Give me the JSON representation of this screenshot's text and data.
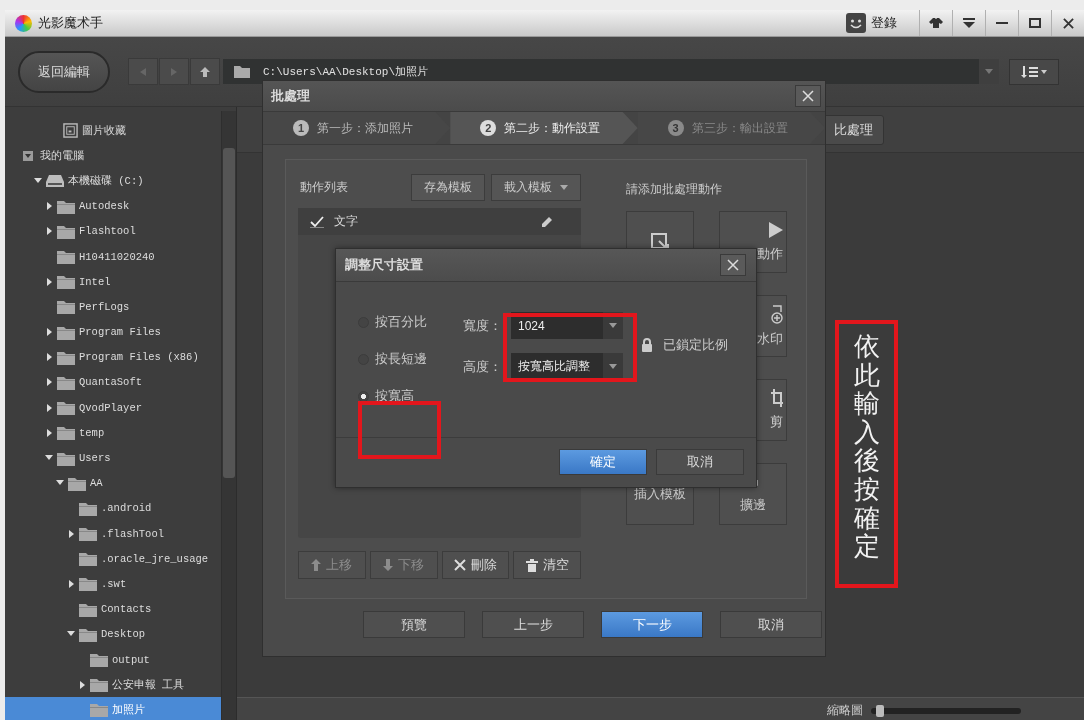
{
  "window": {
    "title": "光影魔术手",
    "login": "登錄"
  },
  "toolbar": {
    "back_button": "返回編輯",
    "path": "C:\\Users\\AA\\Desktop\\加照片"
  },
  "sidebar": {
    "tree": [
      {
        "label": "圖片收藏",
        "kind": "album",
        "expandable": false,
        "expanded": false,
        "selected": false
      },
      {
        "label": "我的電腦",
        "kind": "computer",
        "expandable": true,
        "expanded": true,
        "selected": false,
        "children": [
          {
            "label": "本機磁碟 (C:)",
            "kind": "drive",
            "expandable": true,
            "expanded": true,
            "selected": false,
            "children": [
              {
                "label": "Autodesk",
                "kind": "folder",
                "expandable": true,
                "expanded": false,
                "selected": false
              },
              {
                "label": "Flashtool",
                "kind": "folder",
                "expandable": true,
                "expanded": false,
                "selected": false
              },
              {
                "label": "H10411020240",
                "kind": "folder",
                "expandable": false,
                "expanded": false,
                "selected": false
              },
              {
                "label": "Intel",
                "kind": "folder",
                "expandable": true,
                "expanded": false,
                "selected": false
              },
              {
                "label": "PerfLogs",
                "kind": "folder",
                "expandable": false,
                "expanded": false,
                "selected": false
              },
              {
                "label": "Program Files",
                "kind": "folder",
                "expandable": true,
                "expanded": false,
                "selected": false
              },
              {
                "label": "Program Files (x86)",
                "kind": "folder",
                "expandable": true,
                "expanded": false,
                "selected": false
              },
              {
                "label": "QuantaSoft",
                "kind": "folder",
                "expandable": true,
                "expanded": false,
                "selected": false
              },
              {
                "label": "QvodPlayer",
                "kind": "folder",
                "expandable": true,
                "expanded": false,
                "selected": false
              },
              {
                "label": "temp",
                "kind": "folder",
                "expandable": true,
                "expanded": false,
                "selected": false
              },
              {
                "label": "Users",
                "kind": "folder",
                "expandable": true,
                "expanded": true,
                "selected": false,
                "children": [
                  {
                    "label": "AA",
                    "kind": "folder",
                    "expandable": true,
                    "expanded": true,
                    "selected": false,
                    "children": [
                      {
                        "label": ".android",
                        "kind": "folder",
                        "expandable": false,
                        "expanded": false,
                        "selected": false
                      },
                      {
                        "label": ".flashTool",
                        "kind": "folder",
                        "expandable": true,
                        "expanded": false,
                        "selected": false
                      },
                      {
                        "label": ".oracle_jre_usage",
                        "kind": "folder",
                        "expandable": false,
                        "expanded": false,
                        "selected": false
                      },
                      {
                        "label": ".swt",
                        "kind": "folder",
                        "expandable": true,
                        "expanded": false,
                        "selected": false
                      },
                      {
                        "label": "Contacts",
                        "kind": "folder",
                        "expandable": false,
                        "expanded": false,
                        "selected": false
                      },
                      {
                        "label": "Desktop",
                        "kind": "folder",
                        "expandable": true,
                        "expanded": true,
                        "selected": false,
                        "children": [
                          {
                            "label": "output",
                            "kind": "folder",
                            "expandable": false,
                            "expanded": false,
                            "selected": false
                          },
                          {
                            "label": "公安申報 工具",
                            "kind": "folder",
                            "expandable": true,
                            "expanded": false,
                            "selected": false
                          },
                          {
                            "label": "加照片",
                            "kind": "folder",
                            "expandable": false,
                            "expanded": false,
                            "selected": true
                          }
                        ]
                      }
                    ]
                  }
                ]
              }
            ]
          }
        ]
      }
    ]
  },
  "content": {
    "batch_button": "比處理",
    "status_bar": {
      "thumbnail_label": "縮略圖",
      "zoom": {
        "level": 0.03
      }
    }
  },
  "batch_dialog": {
    "title": "批處理",
    "steps": [
      {
        "number": "1",
        "label": "第一步：添加照片",
        "selected": false,
        "disabled": false
      },
      {
        "number": "2",
        "label": "第二步：動作設置",
        "selected": true,
        "disabled": false
      },
      {
        "number": "3",
        "label": "第三步：輸出設置",
        "selected": false,
        "disabled": true
      }
    ],
    "action_list": {
      "title": "動作列表",
      "save_template": "存為模板",
      "load_template": "載入模板",
      "items": [
        {
          "label": "文字",
          "checked": true
        }
      ],
      "buttons": [
        {
          "label": "上移",
          "kind": "up",
          "disabled": true
        },
        {
          "label": "下移",
          "kind": "down",
          "disabled": true
        },
        {
          "label": "刪除",
          "kind": "delete",
          "disabled": false
        },
        {
          "label": "清空",
          "kind": "clear",
          "disabled": false
        }
      ]
    },
    "actions": {
      "title": "請添加批處理動作",
      "items": [
        {
          "kind": "resize"
        },
        {
          "kind": "play",
          "label": "動作"
        },
        {
          "kind": "watermark",
          "label": "水印"
        },
        {
          "kind": "crop",
          "label": "剪"
        },
        {
          "kind": "template",
          "label": "插入模板"
        },
        {
          "kind": "border",
          "label": "擴邊"
        }
      ]
    },
    "footer": [
      {
        "label": "預覽",
        "kind": "normal"
      },
      {
        "label": "上一步",
        "kind": "normal"
      },
      {
        "label": "下一步",
        "kind": "primary"
      },
      {
        "label": "取消",
        "kind": "normal"
      }
    ]
  },
  "resize_dialog": {
    "title": "調整尺寸設置",
    "modes": [
      {
        "label": "按百分比",
        "selected": false
      },
      {
        "label": "按長短邊",
        "selected": false
      },
      {
        "label": "按寬高",
        "selected": true
      }
    ],
    "width": {
      "label": "寬度：",
      "value": "1024"
    },
    "height": {
      "label": "高度：",
      "value": "按寬高比調整"
    },
    "lock_label": "已鎖定比例",
    "buttons": [
      {
        "label": "確定",
        "kind": "primary"
      },
      {
        "label": "取消",
        "kind": "normal"
      }
    ]
  },
  "annotation": {
    "text": "依此輸入後按確定"
  }
}
